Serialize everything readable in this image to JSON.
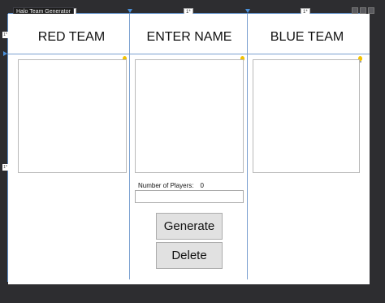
{
  "window": {
    "title": "Halo Team Generator"
  },
  "designer": {
    "column_width_marker": "1*",
    "row_height_marker": "1*"
  },
  "columns": {
    "red": {
      "header": "RED TEAM"
    },
    "name": {
      "header": "ENTER NAME"
    },
    "blue": {
      "header": "BLUE TEAM"
    }
  },
  "players": {
    "label": "Number of Players:",
    "count": "0",
    "input_value": ""
  },
  "buttons": {
    "generate": "Generate",
    "delete": "Delete"
  },
  "colors": {
    "guide_line": "#7aa0d0",
    "ruler_marker": "#4a90d9",
    "hint_bulb": "#f2c200"
  }
}
